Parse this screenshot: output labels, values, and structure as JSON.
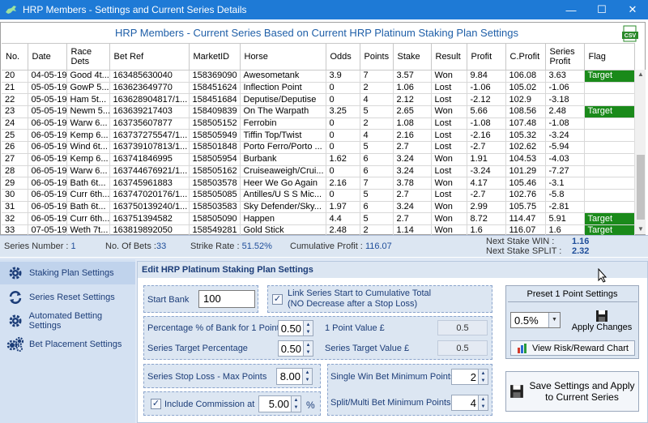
{
  "window": {
    "title": "HRP Members - Settings and Current Series Details",
    "minimize": "—",
    "maximize": "☐",
    "close": "✕"
  },
  "grid": {
    "title": "HRP Members - Current Series Based on Current HRP Platinum Staking Plan Settings",
    "csv_icon": "csv-export-icon",
    "columns": [
      "No.",
      "Date",
      "Race Dets",
      "Bet Ref",
      "MarketID",
      "Horse",
      "Odds",
      "Points",
      "Stake",
      "Result",
      "Profit",
      "C.Profit",
      "Series Profit",
      "Flag"
    ],
    "rows": [
      [
        "20",
        "04-05-19",
        "Good 4t...",
        "163485630040",
        "158369090",
        "Awesometank",
        "3.9",
        "7",
        "3.57",
        "Won",
        "9.84",
        "106.08",
        "3.63",
        "Target"
      ],
      [
        "21",
        "05-05-19",
        "GowP 5...",
        "163623649770",
        "158451624",
        "Inflection Point",
        "0",
        "2",
        "1.06",
        "Lost",
        "-1.06",
        "105.02",
        "-1.06",
        ""
      ],
      [
        "22",
        "05-05-19",
        "Ham  5t...",
        "163628904817/1...",
        "158451684",
        "Deputise/Deputise",
        "0",
        "4",
        "2.12",
        "Lost",
        "-2.12",
        "102.9",
        "-3.18",
        ""
      ],
      [
        "23",
        "05-05-19",
        "Newm 5...",
        "163639217403",
        "158409839",
        "On The Warpath",
        "3.25",
        "5",
        "2.65",
        "Won",
        "5.66",
        "108.56",
        "2.48",
        "Target"
      ],
      [
        "24",
        "06-05-19",
        "Warw 6...",
        "163735607877",
        "158505152",
        "Ferrobin",
        "0",
        "2",
        "1.08",
        "Lost",
        "-1.08",
        "107.48",
        "-1.08",
        ""
      ],
      [
        "25",
        "06-05-19",
        "Kemp 6...",
        "163737275547/1...",
        "158505949",
        "Tiffin Top/Twist",
        "0",
        "4",
        "2.16",
        "Lost",
        "-2.16",
        "105.32",
        "-3.24",
        ""
      ],
      [
        "26",
        "06-05-19",
        "Wind 6t...",
        "163739107813/1...",
        "158501848",
        "Porto Ferro/Porto ...",
        "0",
        "5",
        "2.7",
        "Lost",
        "-2.7",
        "102.62",
        "-5.94",
        ""
      ],
      [
        "27",
        "06-05-19",
        "Kemp 6...",
        "163741846995",
        "158505954",
        "Burbank",
        "1.62",
        "6",
        "3.24",
        "Won",
        "1.91",
        "104.53",
        "-4.03",
        ""
      ],
      [
        "28",
        "06-05-19",
        "Warw 6...",
        "163744676921/1...",
        "158505162",
        "Cruiseaweigh/Crui...",
        "0",
        "6",
        "3.24",
        "Lost",
        "-3.24",
        "101.29",
        "-7.27",
        ""
      ],
      [
        "29",
        "06-05-19",
        "Bath 6t...",
        "163745961883",
        "158503578",
        "Heer We Go Again",
        "2.16",
        "7",
        "3.78",
        "Won",
        "4.17",
        "105.46",
        "-3.1",
        ""
      ],
      [
        "30",
        "06-05-19",
        "Curr 6th...",
        "163747020176/1...",
        "158505085",
        "Antilles/U S S Mic...",
        "0",
        "5",
        "2.7",
        "Lost",
        "-2.7",
        "102.76",
        "-5.8",
        ""
      ],
      [
        "31",
        "06-05-19",
        "Bath 6t...",
        "163750139240/1...",
        "158503583",
        "Sky Defender/Sky...",
        "1.97",
        "6",
        "3.24",
        "Won",
        "2.99",
        "105.75",
        "-2.81",
        ""
      ],
      [
        "32",
        "06-05-19",
        "Curr 6th...",
        "163751394582",
        "158505090",
        "Happen",
        "4.4",
        "5",
        "2.7",
        "Won",
        "8.72",
        "114.47",
        "5.91",
        "Target"
      ],
      [
        "33",
        "07-05-19",
        "Weth 7t...",
        "163819892050",
        "158549281",
        "Gold Stick",
        "2.48",
        "2",
        "1.14",
        "Won",
        "1.6",
        "116.07",
        "1.6",
        "Target"
      ]
    ]
  },
  "status": {
    "series_number_label": "Series Number :",
    "series_number": "1",
    "num_bets_label": "No. Of Bets :",
    "num_bets": "33",
    "strike_rate_label": "Strike Rate :",
    "strike_rate": "51.52%",
    "cum_profit_label": "Cumulative Profit :",
    "cum_profit": "116.07",
    "next_win_label": "Next Stake WIN :",
    "next_win": "1.16",
    "next_split_label": "Next Stake SPLIT :",
    "next_split": "2.32"
  },
  "sidebar": {
    "items": [
      {
        "label": "Staking Plan Settings",
        "icon": "gear-icon"
      },
      {
        "label": "Series Reset Settings",
        "icon": "refresh-icon"
      },
      {
        "label": "Automated Betting Settings",
        "icon": "gear-icon"
      },
      {
        "label": "Bet Placement Settings",
        "icon": "gears-icon"
      }
    ]
  },
  "panel": {
    "header": "Edit HRP Platinum Staking Plan Settings",
    "start_bank_label": "Start Bank",
    "start_bank": "100",
    "link_series_label_1": "Link Series Start to Cumulative Total",
    "link_series_label_2": "(NO Decrease after a Stop Loss)",
    "link_series_checked": "✓",
    "pct_bank_label": "Percentage % of Bank for 1 Point",
    "pct_bank": "0.50",
    "one_point_label": "1 Point Value £",
    "one_point_value": "0.5",
    "series_target_pct_label": "Series Target Percentage",
    "series_target_pct": "0.50",
    "series_target_value_label": "Series Target Value £",
    "series_target_value": "0.5",
    "stop_loss_label": "Series Stop Loss - Max Points",
    "stop_loss": "8.00",
    "single_win_label": "Single Win Bet Minimum Points",
    "single_win": "2",
    "split_multi_label": "Split/Multi  Bet Minimum Points",
    "split_multi": "4",
    "commission_label": "Include Commission at",
    "commission_checked": "✓",
    "commission": "5.00",
    "commission_unit": "%",
    "preset_title": "Preset 1 Point Settings",
    "preset_value": "0.5%",
    "apply_label": "Apply Changes",
    "risk_label": "View Risk/Reward Chart",
    "save_label_1": "Save Settings and Apply",
    "save_label_2": "to Current Series"
  },
  "colors": {
    "titlebar": "#1e7ad6",
    "target": "#1a8a1a",
    "accent": "#1c3d78"
  }
}
